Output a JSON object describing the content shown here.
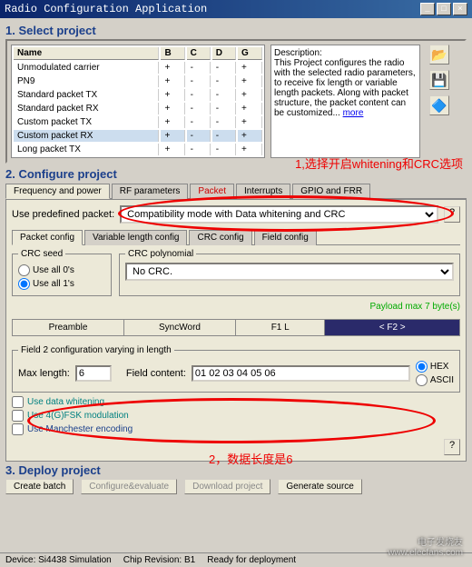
{
  "window": {
    "title": "Radio Configuration Application"
  },
  "section1": {
    "title": "1. Select project",
    "columns": [
      "Name",
      "B",
      "C",
      "D",
      "G"
    ],
    "rows": [
      {
        "name": "Unmodulated carrier",
        "b": "+",
        "c": "-",
        "d": "-",
        "g": "+"
      },
      {
        "name": "PN9",
        "b": "+",
        "c": "-",
        "d": "-",
        "g": "+"
      },
      {
        "name": "Standard packet TX",
        "b": "+",
        "c": "-",
        "d": "-",
        "g": "+"
      },
      {
        "name": "Standard packet RX",
        "b": "+",
        "c": "-",
        "d": "-",
        "g": "+"
      },
      {
        "name": "Custom packet TX",
        "b": "+",
        "c": "-",
        "d": "-",
        "g": "+"
      },
      {
        "name": "Custom packet RX",
        "b": "+",
        "c": "-",
        "d": "-",
        "g": "+",
        "selected": true
      },
      {
        "name": "Long packet TX",
        "b": "+",
        "c": "-",
        "d": "-",
        "g": "+"
      }
    ],
    "desc_label": "Description:",
    "desc_text": "This Project configures the radio with the selected radio parameters, to receive fix length or variable length packets. Along with packet structure, the packet content can be customized... ",
    "more": "more"
  },
  "section2": {
    "title": "2. Configure project",
    "main_tabs": [
      "Frequency and power",
      "RF parameters",
      "Packet",
      "Interrupts",
      "GPIO and FRR"
    ],
    "predef_label": "Use predefined packet:",
    "predef_value": "Compatibility mode with Data whitening and CRC",
    "sub_tabs": [
      "Packet config",
      "Variable length config",
      "CRC config",
      "Field config"
    ],
    "crc_seed": {
      "legend": "CRC seed",
      "opt0": "Use all 0's",
      "opt1": "Use all 1's"
    },
    "crc_poly": {
      "legend": "CRC polynomial",
      "value": "No CRC."
    },
    "payload_label": "Payload max 7 byte(s)",
    "pkt": {
      "preamble": "Preamble",
      "sync": "SyncWord",
      "f1l": "F1 L",
      "f2": "< F2 >"
    },
    "field2": {
      "legend": "Field 2 configuration varying in length",
      "maxlen_label": "Max length:",
      "maxlen_value": "6",
      "content_label": "Field content:",
      "content_value": "01 02 03 04 05 06",
      "hex": "HEX",
      "ascii": "ASCII"
    },
    "chk_whitening": "Use data whitening",
    "chk_4gfsk": "Use 4(G)FSK modulation",
    "chk_manchester": "Use Manchester encoding"
  },
  "section3": {
    "title": "3. Deploy project",
    "btn_batch": "Create batch",
    "btn_conf": "Configure&evaluate",
    "btn_download": "Download project",
    "btn_source": "Generate source"
  },
  "status": {
    "device": "Device: Si4438  Simulation",
    "rev": "Chip Revision: B1",
    "ready": "Ready for deployment"
  },
  "annotations": {
    "a1": "1,选择开启whitening和CRC选项",
    "a2": "2，数据长度是6"
  },
  "watermark": {
    "l1": "电子发烧友",
    "l2": "www.elecfans.com"
  }
}
